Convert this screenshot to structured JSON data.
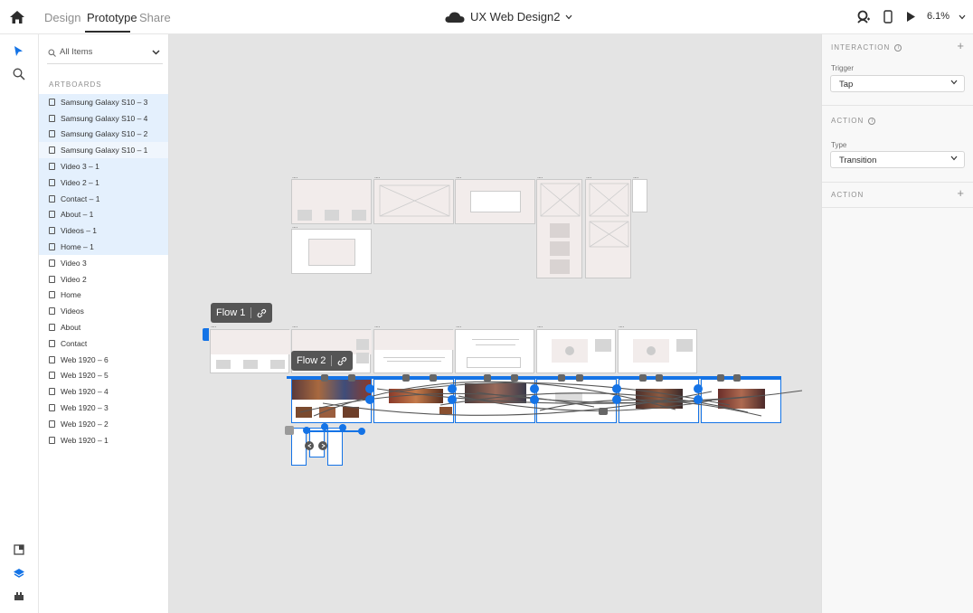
{
  "topbar": {
    "tabs": [
      "Design",
      "Prototype",
      "Share"
    ],
    "document_title": "UX Web Design2",
    "zoom": "6.1%"
  },
  "layers": {
    "search_label": "All Items",
    "section_title": "ARTBOARDS",
    "items": [
      {
        "label": "Samsung Galaxy S10 – 3",
        "state": "selected"
      },
      {
        "label": "Samsung Galaxy S10 – 4",
        "state": "selected"
      },
      {
        "label": "Samsung Galaxy S10 – 2",
        "state": "selected"
      },
      {
        "label": "Samsung Galaxy S10 – 1",
        "state": "hover"
      },
      {
        "label": "Video 3 – 1",
        "state": "selected"
      },
      {
        "label": "Video 2 – 1",
        "state": "selected"
      },
      {
        "label": "Contact – 1",
        "state": "selected"
      },
      {
        "label": "About – 1",
        "state": "selected"
      },
      {
        "label": "Videos – 1",
        "state": "selected"
      },
      {
        "label": "Home – 1",
        "state": "selected"
      },
      {
        "label": "Video 3",
        "state": "normal"
      },
      {
        "label": "Video 2",
        "state": "normal"
      },
      {
        "label": "Home",
        "state": "normal"
      },
      {
        "label": "Videos",
        "state": "normal"
      },
      {
        "label": "About",
        "state": "normal"
      },
      {
        "label": "Contact",
        "state": "normal"
      },
      {
        "label": "Web 1920 – 6",
        "state": "normal"
      },
      {
        "label": "Web 1920 – 5",
        "state": "normal"
      },
      {
        "label": "Web 1920 – 4",
        "state": "normal"
      },
      {
        "label": "Web 1920 – 3",
        "state": "normal"
      },
      {
        "label": "Web 1920 – 2",
        "state": "normal"
      },
      {
        "label": "Web 1920 – 1",
        "state": "normal"
      }
    ]
  },
  "canvas": {
    "flow1_label": "Flow 1",
    "flow2_label": "Flow 2",
    "artboard_dots": "...."
  },
  "properties": {
    "interaction_title": "INTERACTION",
    "trigger_label": "Trigger",
    "trigger_value": "Tap",
    "action_title": "ACTION",
    "type_label": "Type",
    "type_value": "Transition",
    "action2_title": "ACTION"
  },
  "colors": {
    "accent": "#1473e6",
    "selected_row": "#e4f0fd",
    "canvas": "#e4e4e4",
    "flow_tag": "#555555"
  }
}
